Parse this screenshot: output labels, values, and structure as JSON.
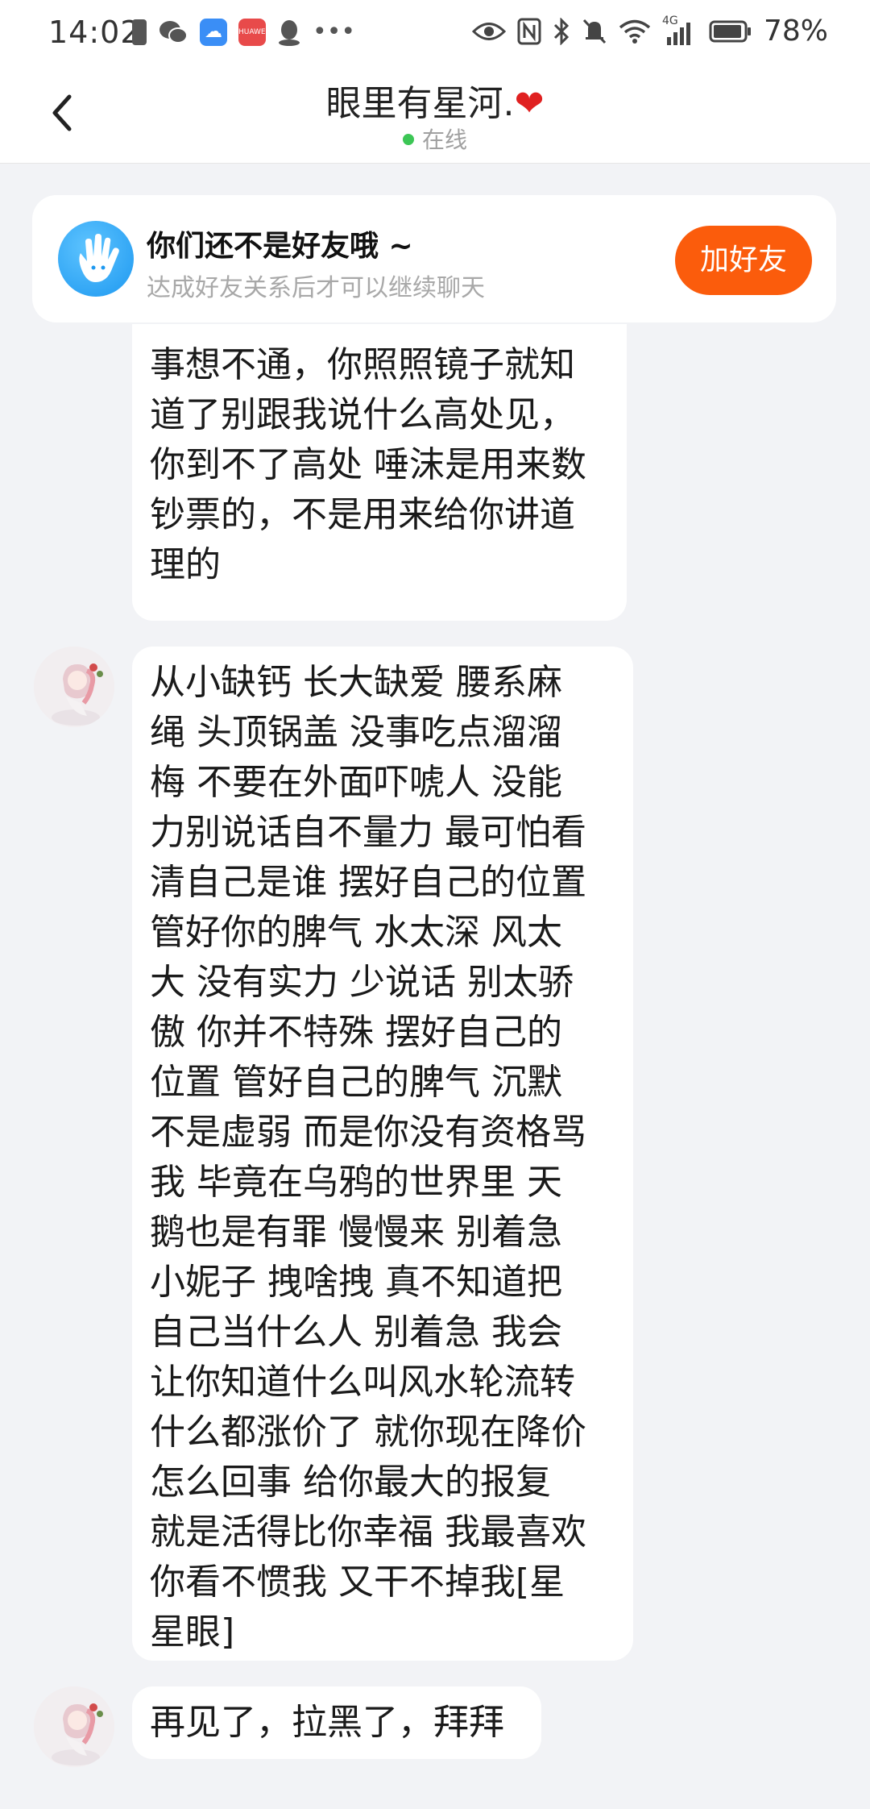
{
  "status_bar": {
    "time": "14:02",
    "battery_percent": "78%",
    "network_label": "4G",
    "carrier_badge": "HUAWEI"
  },
  "header": {
    "title": "眼里有星河.",
    "title_emoji": "❤",
    "presence": "在线"
  },
  "friend_notice": {
    "title": "你们还不是好友哦 ~",
    "subtitle": "达成好友关系后才可以继续聊天",
    "button_label": "加好友"
  },
  "messages": [
    {
      "lines": [
        "事想不通，你照照镜子就知",
        "道了别跟我说什么高处见，",
        "你到不了高处 唾沫是用来数",
        "钞票的，不是用来给你讲道",
        "理的"
      ]
    },
    {
      "lines": [
        "从小缺钙 长大缺爱  腰系麻",
        "绳  头顶锅盖 没事吃点溜溜",
        "梅 不要在外面吓唬人 没能",
        "力别说话自不量力 最可怕看",
        "清自己是谁 摆好自己的位置",
        "管好你的脾气 水太深 风太",
        "大 没有实力 少说话 别太骄",
        "傲 你并不特殊 摆好自己的",
        "位置 管好自己的脾气 沉默",
        "不是虚弱 而是你没有资格骂",
        "我 毕竟在乌鸦的世界里 天",
        "鹅也是有罪 慢慢来 别着急",
        "小妮子 拽啥拽 真不知道把",
        "自己当什么人 别着急 我会",
        "让你知道什么叫风水轮流转",
        "什么都涨价了 就你现在降价",
        "怎么回事 给你最大的报复",
        "就是活得比你幸福 我最喜欢",
        "你看不惯我 又干不掉我[星",
        "星眼]"
      ]
    },
    {
      "lines": [
        "再见了，拉黑了，拜拜"
      ]
    }
  ]
}
